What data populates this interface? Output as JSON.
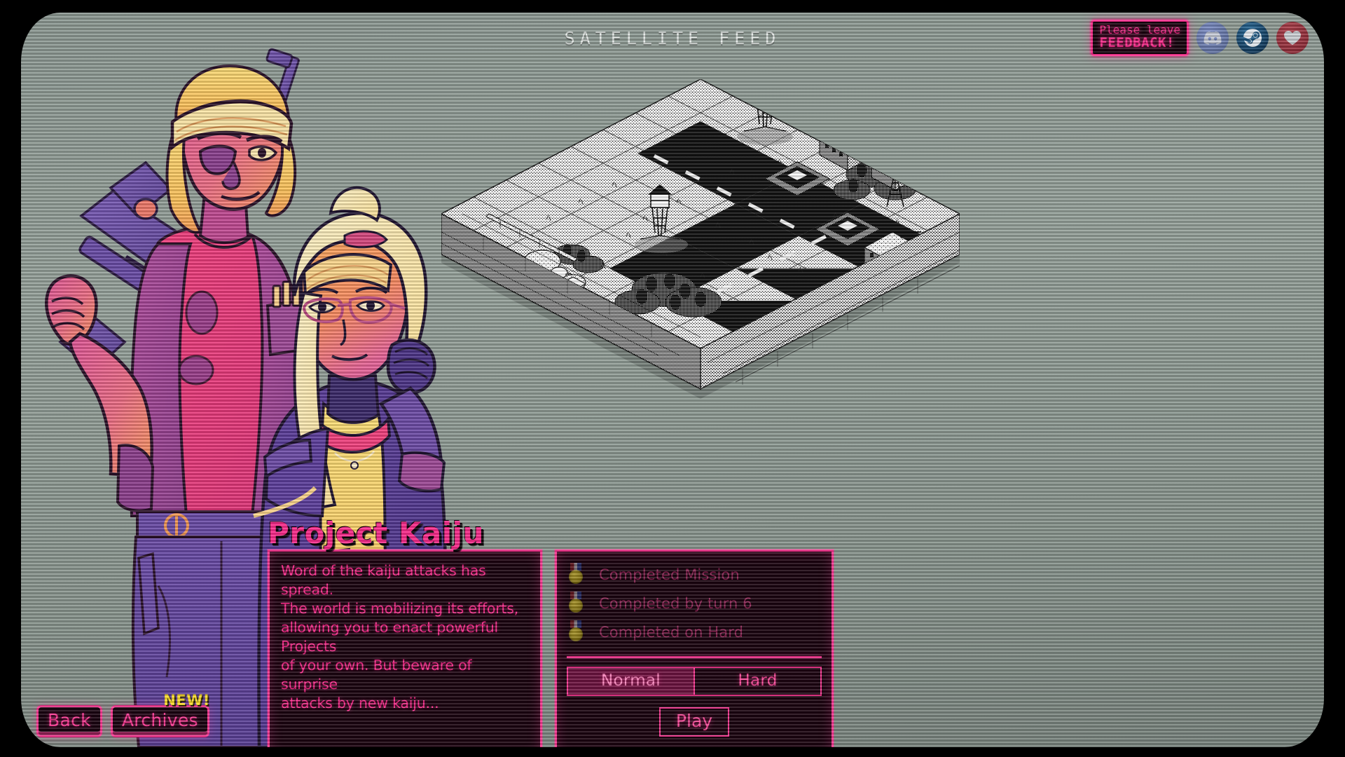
{
  "header": {
    "feed_title": "SATELLITE FEED"
  },
  "topright": {
    "feedback": {
      "line1": "Please leave",
      "line2": "FEEDBACK!"
    },
    "socials": [
      {
        "name": "discord-icon",
        "label": "Discord"
      },
      {
        "name": "steam-icon",
        "label": "Steam"
      },
      {
        "name": "wishlist-heart-icon",
        "label": "Wishlist"
      }
    ]
  },
  "mission": {
    "title": "Project Kaiju",
    "description": "Word of the kaiju attacks has spread.\nThe world is mobilizing its efforts,\nallowing you to enact powerful Projects\nof your own. But beware of surprise\nattacks by new kaiju...",
    "objectives": [
      {
        "label": "Completed Mission",
        "earned": false
      },
      {
        "label": "Completed by turn 6",
        "earned": false
      },
      {
        "label": "Completed on Hard",
        "earned": false
      }
    ],
    "difficulties": [
      {
        "label": "Normal",
        "selected": true
      },
      {
        "label": "Hard",
        "selected": false
      }
    ],
    "play_label": "Play"
  },
  "nav": {
    "back_label": "Back",
    "archives_label": "Archives",
    "new_badge": "NEW!"
  },
  "colors": {
    "accent_pink": "#ff2d8f",
    "accent_pink_border": "#ff3a96",
    "panel_bg": "#1a030f",
    "objective_text": "#8e2656",
    "selected_fill": "#6e1340",
    "badge_yellow": "#ffe02e",
    "crt_bg": "#8e9a94"
  }
}
